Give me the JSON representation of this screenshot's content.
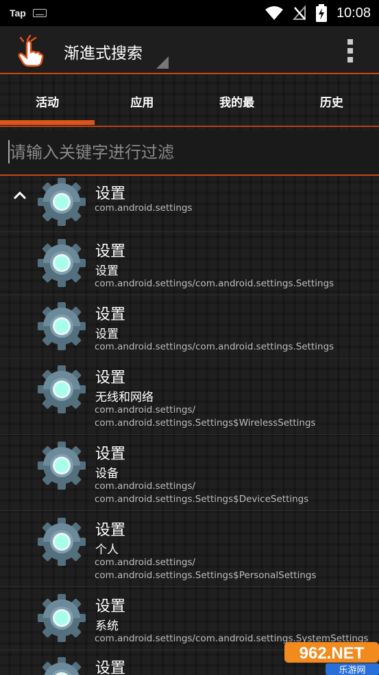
{
  "status_bar": {
    "left_label": "Tap",
    "time": "10:08",
    "icons": [
      "keyboard-icon",
      "wifi-icon",
      "no-signal-icon",
      "battery-charging-icon"
    ]
  },
  "app_bar": {
    "title": "渐進式搜索",
    "icon": "tap-hand-icon",
    "menu_icon": "overflow-menu-icon"
  },
  "tabs": [
    {
      "label": "活动",
      "selected": true
    },
    {
      "label": "应用",
      "selected": false
    },
    {
      "label": "我的最",
      "selected": false
    },
    {
      "label": "历史",
      "selected": false
    }
  ],
  "search": {
    "placeholder": "请输入关键字进行过滤",
    "value": ""
  },
  "items": [
    {
      "title": "设置",
      "subtitle": "",
      "package": [
        "com.android.settings"
      ],
      "expanded": true
    },
    {
      "title": "设置",
      "subtitle": "设置",
      "package": [
        "com.android.settings/com.android.settings.Settings"
      ]
    },
    {
      "title": "设置",
      "subtitle": "设置",
      "package": [
        "com.android.settings/com.android.settings.Settings"
      ]
    },
    {
      "title": "设置",
      "subtitle": "无线和网络",
      "package": [
        "com.android.settings/",
        "com.android.settings.Settings$WirelessSettings"
      ]
    },
    {
      "title": "设置",
      "subtitle": "设备",
      "package": [
        "com.android.settings/",
        "com.android.settings.Settings$DeviceSettings"
      ]
    },
    {
      "title": "设置",
      "subtitle": "个人",
      "package": [
        "com.android.settings/",
        "com.android.settings.Settings$PersonalSettings"
      ]
    },
    {
      "title": "设置",
      "subtitle": "系统",
      "package": [
        "com.android.settings/com.android.settings.SystemSettings"
      ]
    },
    {
      "title": "设置",
      "subtitle": "",
      "package": []
    }
  ],
  "watermark": {
    "brand": "962.NET",
    "site": "乐游网"
  },
  "colors": {
    "accent": "#e0531a",
    "gear_dark": "#54707e",
    "gear_light": "#7fa0ae",
    "gear_center": "#a7ffeb"
  }
}
